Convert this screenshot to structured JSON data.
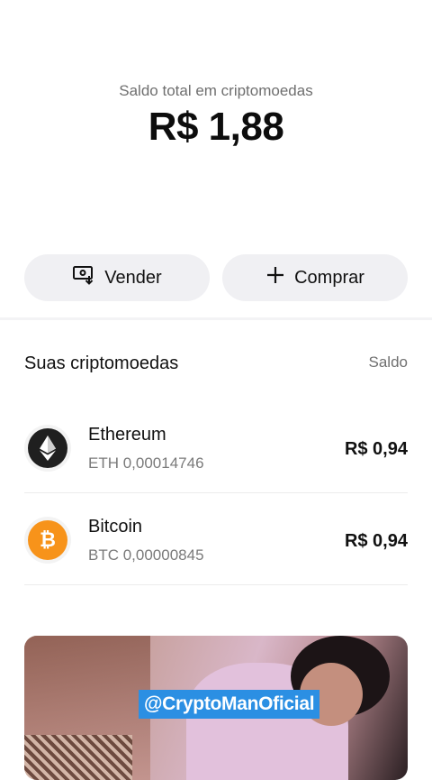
{
  "balance": {
    "label": "Saldo total em criptomoedas",
    "value": "R$ 1,88"
  },
  "actions": {
    "sell_label": "Vender",
    "buy_label": "Comprar"
  },
  "section": {
    "title": "Suas criptomoedas",
    "column_label": "Saldo"
  },
  "coins": [
    {
      "name": "Ethereum",
      "amount": "ETH 0,00014746",
      "value": "R$ 0,94",
      "icon": "ethereum-icon",
      "color": "#1f1f1f"
    },
    {
      "name": "Bitcoin",
      "amount": "BTC 0,00000845",
      "value": "R$ 0,94",
      "icon": "bitcoin-icon",
      "color": "#f7931a"
    }
  ],
  "banner": {
    "watermark": "@CryptoManOficial"
  }
}
